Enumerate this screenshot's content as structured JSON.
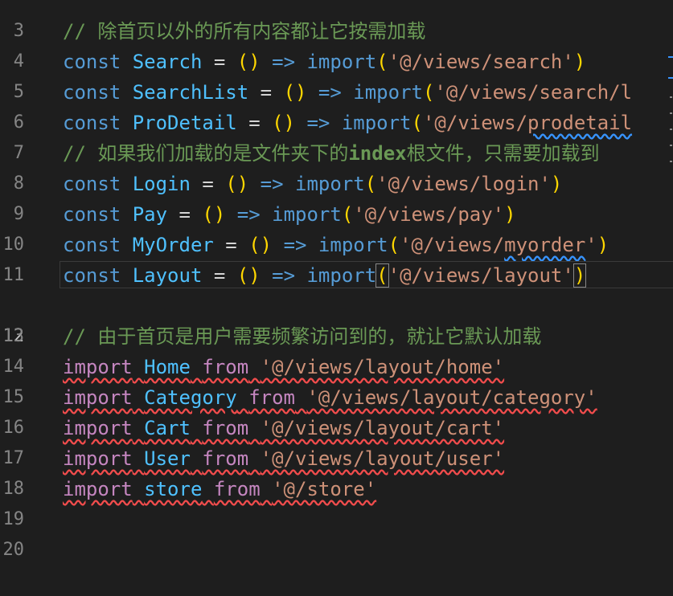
{
  "editor": {
    "current_line": "12",
    "lines": [
      {
        "num": "3",
        "text": ""
      },
      {
        "num": "4",
        "comment": "// 除首页以外的所有内容都让它按需加载"
      },
      {
        "num": "5",
        "kw": "const",
        "name": "Search",
        "eq": " = ",
        "open": "()",
        "arrow": " => ",
        "fn": "import",
        "p1": "(",
        "str": "'@/views/search'",
        "p2": ")"
      },
      {
        "num": "6",
        "kw": "const",
        "name": "SearchList",
        "eq": " = ",
        "open": "()",
        "arrow": " => ",
        "fn": "import",
        "p1": "(",
        "str": "'@/views/search/l"
      },
      {
        "num": "7",
        "kw": "const",
        "name": "ProDetail",
        "eq": " = ",
        "open": "()",
        "arrow": " => ",
        "fn": "import",
        "p1": "(",
        "str_a": "'@/views/",
        "str_b": "prodetail"
      },
      {
        "num": "8",
        "comment_a": "// 如果我们加载的是文件夹下的",
        "comment_b": "index",
        "comment_c": "根文件，只需要加载到"
      },
      {
        "num": "9",
        "kw": "const",
        "name": "Login",
        "eq": " = ",
        "open": "()",
        "arrow": " => ",
        "fn": "import",
        "p1": "(",
        "str": "'@/views/login'",
        "p2": ")"
      },
      {
        "num": "10",
        "kw": "const",
        "name": "Pay",
        "eq": " = ",
        "open": "()",
        "arrow": " => ",
        "fn": "import",
        "p1": "(",
        "str": "'@/views/pay'",
        "p2": ")"
      },
      {
        "num": "11",
        "kw": "const",
        "name": "MyOrder",
        "eq": " = ",
        "open": "()",
        "arrow": " => ",
        "fn": "import",
        "p1": "(",
        "str_a": "'@/views/",
        "str_b": "myorder",
        "str_c": "'",
        "p2": ")"
      },
      {
        "num": "12",
        "kw": "const",
        "name": "Layout",
        "eq": " = ",
        "open": "()",
        "arrow": " => ",
        "fn": "import",
        "p1": "(",
        "str": "'@/views/layout'",
        "p2": ")"
      },
      {
        "num": "13",
        "text": ""
      },
      {
        "num": "14",
        "comment": "// 由于首页是用户需要频繁访问到的，就让它默认加载"
      },
      {
        "num": "15",
        "kw": "import",
        "name": "Home",
        "from": "from",
        "str": "'@/views/layout/home'"
      },
      {
        "num": "16",
        "kw": "import",
        "name": "Category",
        "from": "from",
        "str": "'@/views/layout/category'"
      },
      {
        "num": "17",
        "kw": "import",
        "name": "Cart",
        "from": "from",
        "str": "'@/views/layout/cart'"
      },
      {
        "num": "18",
        "kw": "import",
        "name": "User",
        "from": "from",
        "str": "'@/views/layout/user'"
      },
      {
        "num": "19",
        "kw": "import",
        "name": "store",
        "from": "from",
        "str": "'@/store'"
      },
      {
        "num": "20",
        "text": ""
      }
    ]
  }
}
